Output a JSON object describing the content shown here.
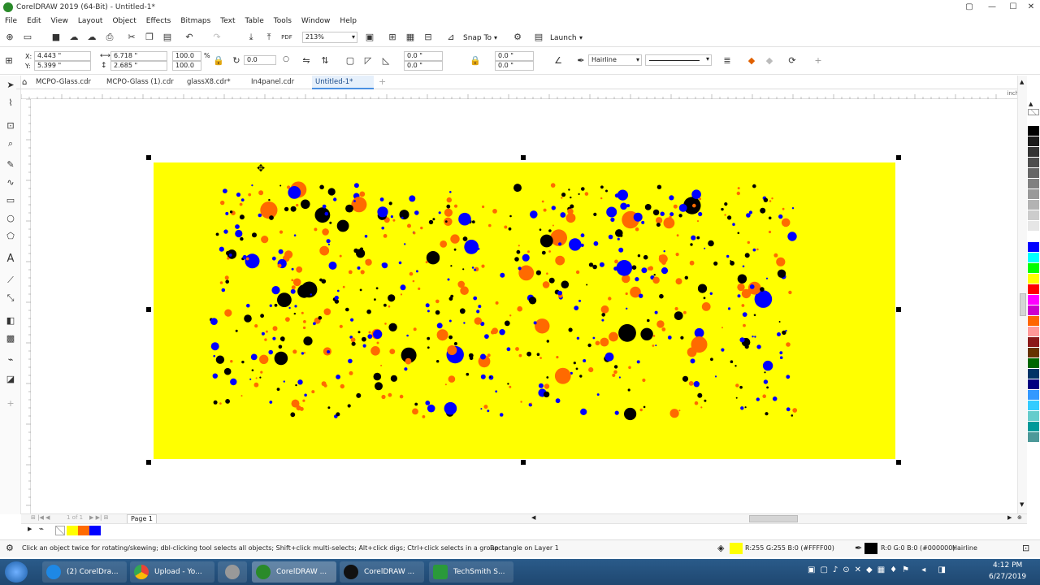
{
  "app": {
    "title": "CorelDRAW 2019 (64-Bit) - Untitled-1*",
    "logo_icon": "coreldraw-logo-icon",
    "controls": {
      "restore": "▢",
      "minimize": "—",
      "maximize": "☐",
      "close": "✕"
    }
  },
  "menu": [
    "File",
    "Edit",
    "View",
    "Layout",
    "Object",
    "Effects",
    "Bitmaps",
    "Text",
    "Table",
    "Tools",
    "Window",
    "Help"
  ],
  "toolbar": {
    "zoom": "213%",
    "snap_to": "Snap To",
    "launch": "Launch"
  },
  "property_bar": {
    "x": "4.443 \"",
    "y": "5.399 \"",
    "width": "6.718 \"",
    "height": "2.685 \"",
    "scale_x": "100.0",
    "scale_y": "100.0",
    "scale_unit": "%",
    "rotation": "0.0",
    "corner_tl": "0.0 \"",
    "corner_bl": "0.0 \"",
    "corner_tr": "0.0 \"",
    "corner_br": "0.0 \"",
    "outline_width": "Hairline"
  },
  "tabs": [
    {
      "label": "MCPO-Glass.cdr",
      "active": false
    },
    {
      "label": "MCPO-Glass (1).cdr",
      "active": false
    },
    {
      "label": "glassX8.cdr*",
      "active": false
    },
    {
      "label": "In4panel.cdr",
      "active": false
    },
    {
      "label": "Untitled-1*",
      "active": true
    }
  ],
  "ruler": {
    "unit": "inches"
  },
  "page_nav": {
    "page_label": "Page 1",
    "counter": "1 of 1"
  },
  "doc_colors": [
    "#ffff00",
    "#ff6a00",
    "#0000ff"
  ],
  "palette": [
    "#ffffff",
    "#000000",
    "#1a1a1a",
    "#333333",
    "#4d4d4d",
    "#666666",
    "#808080",
    "#999999",
    "#b3b3b3",
    "#cccccc",
    "#e6e6e6",
    "#ffffff",
    "#0000ff",
    "#00ffff",
    "#00ff00",
    "#ffff00",
    "#ff0000",
    "#ff00ff",
    "#cc00cc",
    "#ff6600",
    "#ff9999",
    "#8b1a1a",
    "#663300",
    "#006600",
    "#003366",
    "#000080",
    "#3399ff",
    "#33ccff",
    "#66cccc",
    "#009999",
    "#4d9999"
  ],
  "status": {
    "hint": "Click an object twice for rotating/skewing; dbl-clicking tool selects all objects; Shift+click multi-selects; Alt+click digs; Ctrl+click selects in a group",
    "object": "Rectangle on Layer 1",
    "fill_color": "#ffff00",
    "fill_info": "R:255 G:255 B:0 (#FFFF00)",
    "outline_color": "#000000",
    "outline_info": "R:0 G:0 B:0 (#000000)",
    "outline_label": "Hairline"
  },
  "taskbar": {
    "buttons": [
      {
        "label": "(2) CorelDra...",
        "color": "#1e88e5"
      },
      {
        "label": "Upload - Yo...",
        "color": "#4285f4"
      },
      {
        "label": "",
        "color": "#999999"
      },
      {
        "label": "CorelDRAW ...",
        "color": "#2a8a2a"
      },
      {
        "label": "CorelDRAW ...",
        "color": "#222222"
      },
      {
        "label": "TechSmith S...",
        "color": "#2a9a3a"
      }
    ],
    "time": "4:12 PM",
    "date": "6/27/2019"
  }
}
